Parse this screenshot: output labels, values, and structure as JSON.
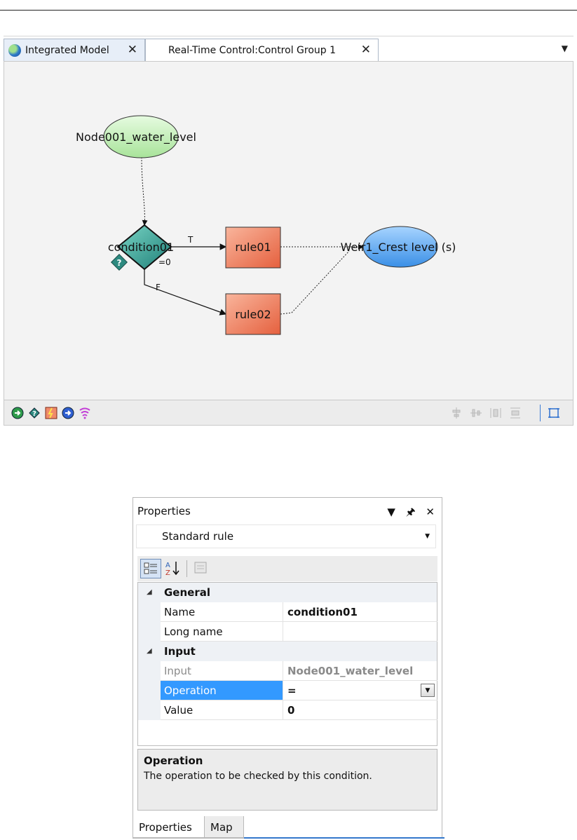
{
  "tabs": [
    {
      "label": "Integrated Model",
      "icon": "globe-icon"
    },
    {
      "label": "Real-Time Control:Control Group 1"
    }
  ],
  "diagram": {
    "input_node": "Node001_water_level",
    "condition_node": "condition01",
    "condition_subtext": "=0",
    "true_label": "T",
    "false_label": "F",
    "rule1": "rule01",
    "rule2": "rule02",
    "output_node": "Weir1_Crest level (s)",
    "colors": {
      "input": "#c9f0c0",
      "condition": "#3aa9a0",
      "rule": "#f08a6a",
      "output": "#5ea8ef"
    }
  },
  "properties": {
    "title": "Properties",
    "selector": "Standard rule",
    "categories": [
      {
        "name": "General",
        "rows": [
          {
            "name": "Name",
            "value": "condition01"
          },
          {
            "name": "Long name",
            "value": ""
          }
        ]
      },
      {
        "name": "Input",
        "rows": [
          {
            "name": "Input",
            "value": "Node001_water_level",
            "readonly": true
          },
          {
            "name": "Operation",
            "value": "=",
            "selected": true
          },
          {
            "name": "Value",
            "value": "0"
          }
        ]
      }
    ],
    "help_title": "Operation",
    "help_desc": "The operation to be checked by this condition.",
    "bottom_tabs": [
      "Properties",
      "Map"
    ]
  }
}
